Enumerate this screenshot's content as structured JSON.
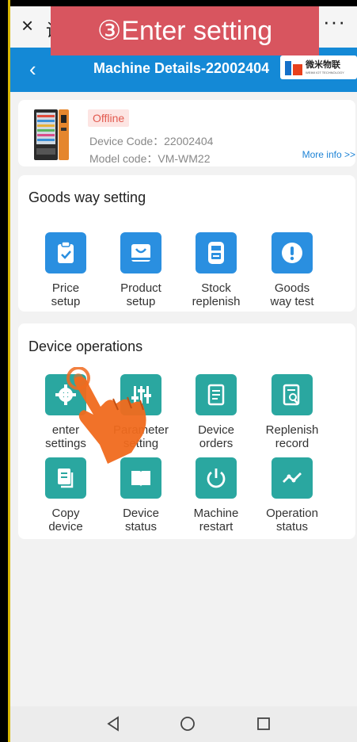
{
  "step_banner": "③Enter setting",
  "topbar": {
    "close_glyph": "×",
    "title_stub": "设",
    "more_glyph": "···"
  },
  "header": {
    "back_glyph": "‹",
    "title": "Machine Details-22002404",
    "brand_cn": "微米物联",
    "brand_en": "WEIMI IOT TECHNOLOGY"
  },
  "device": {
    "status": "Offline",
    "device_code": "Device Code：22002404",
    "model_code": "Model code：VM-WM22",
    "more_info": "More info >>"
  },
  "goods_way": {
    "title": "Goods way setting",
    "items": [
      {
        "label": "Price\nsetup",
        "icon": "clipboard-check-icon"
      },
      {
        "label": "Product\nsetup",
        "icon": "shopping-bag-icon"
      },
      {
        "label": "Stock\nreplenish",
        "icon": "printer-icon"
      },
      {
        "label": "Goods\nway test",
        "icon": "alert-icon"
      }
    ]
  },
  "device_ops": {
    "title": "Device operations",
    "items": [
      {
        "label": "enter\nsettings",
        "icon": "gear-icon"
      },
      {
        "label": "Parameter\nsetting",
        "icon": "sliders-icon"
      },
      {
        "label": "Device\norders",
        "icon": "document-icon"
      },
      {
        "label": "Replenish\nrecord",
        "icon": "report-search-icon"
      },
      {
        "label": "Copy\ndevice",
        "icon": "copy-icon"
      },
      {
        "label": "Device\nstatus",
        "icon": "book-icon"
      },
      {
        "label": "Machine\nrestart",
        "icon": "power-icon"
      },
      {
        "label": "Operation\nstatus",
        "icon": "line-chart-icon"
      }
    ]
  },
  "colors": {
    "blue_header": "#1489d6",
    "icon_blue": "#2a8fe0",
    "icon_teal": "#2aa7a0",
    "offline": "#e25a4f",
    "banner": "#d8555f"
  }
}
